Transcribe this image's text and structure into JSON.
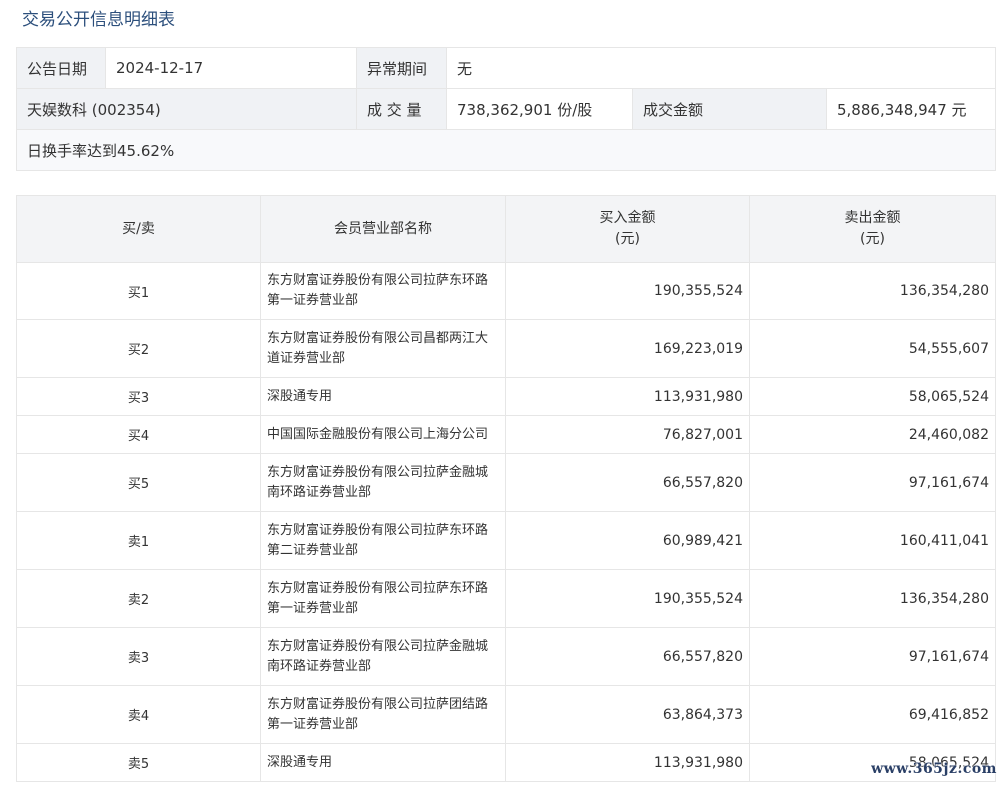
{
  "title": "交易公开信息明细表",
  "info": {
    "row1": {
      "date_label": "公告日期",
      "date_value": "2024-12-17",
      "period_label": "异常期间",
      "period_value": "无"
    },
    "row2": {
      "stock": "天娱数科 (002354)",
      "volume_label": "成 交 量",
      "volume_value": "738,362,901 份/股",
      "amount_label": "成交金额",
      "amount_value": "5,886,348,947 元"
    },
    "row3": {
      "reason": "日换手率达到45.62%"
    }
  },
  "detail": {
    "headers": {
      "side": "买/卖",
      "branch": "会员营业部名称",
      "buy_line1": "买入金额",
      "buy_line2": "(元)",
      "sell_line1": "卖出金额",
      "sell_line2": "(元)"
    },
    "rows": [
      {
        "side": "买1",
        "name_line1": "东方财富证券股份有限公司拉萨东环路",
        "name_line2": "第一证券营业部",
        "buy": "190,355,524",
        "sell": "136,354,280"
      },
      {
        "side": "买2",
        "name_line1": "东方财富证券股份有限公司昌都两江大",
        "name_line2": "道证券营业部",
        "buy": "169,223,019",
        "sell": "54,555,607"
      },
      {
        "side": "买3",
        "name_line1": "深股通专用",
        "name_line2": "",
        "buy": "113,931,980",
        "sell": "58,065,524"
      },
      {
        "side": "买4",
        "name_line1": "中国国际金融股份有限公司上海分公司",
        "name_line2": "",
        "buy": "76,827,001",
        "sell": "24,460,082"
      },
      {
        "side": "买5",
        "name_line1": "东方财富证券股份有限公司拉萨金融城",
        "name_line2": "南环路证券营业部",
        "buy": "66,557,820",
        "sell": "97,161,674"
      },
      {
        "side": "卖1",
        "name_line1": "东方财富证券股份有限公司拉萨东环路",
        "name_line2": "第二证券营业部",
        "buy": "60,989,421",
        "sell": "160,411,041"
      },
      {
        "side": "卖2",
        "name_line1": "东方财富证券股份有限公司拉萨东环路",
        "name_line2": "第一证券营业部",
        "buy": "190,355,524",
        "sell": "136,354,280"
      },
      {
        "side": "卖3",
        "name_line1": "东方财富证券股份有限公司拉萨金融城",
        "name_line2": "南环路证券营业部",
        "buy": "66,557,820",
        "sell": "97,161,674"
      },
      {
        "side": "卖4",
        "name_line1": "东方财富证券股份有限公司拉萨团结路",
        "name_line2": "第一证券营业部",
        "buy": "63,864,373",
        "sell": "69,416,852"
      },
      {
        "side": "卖5",
        "name_line1": "深股通专用",
        "name_line2": "",
        "buy": "113,931,980",
        "sell": "58,065,524"
      }
    ]
  },
  "watermark": "www.365jz.com"
}
